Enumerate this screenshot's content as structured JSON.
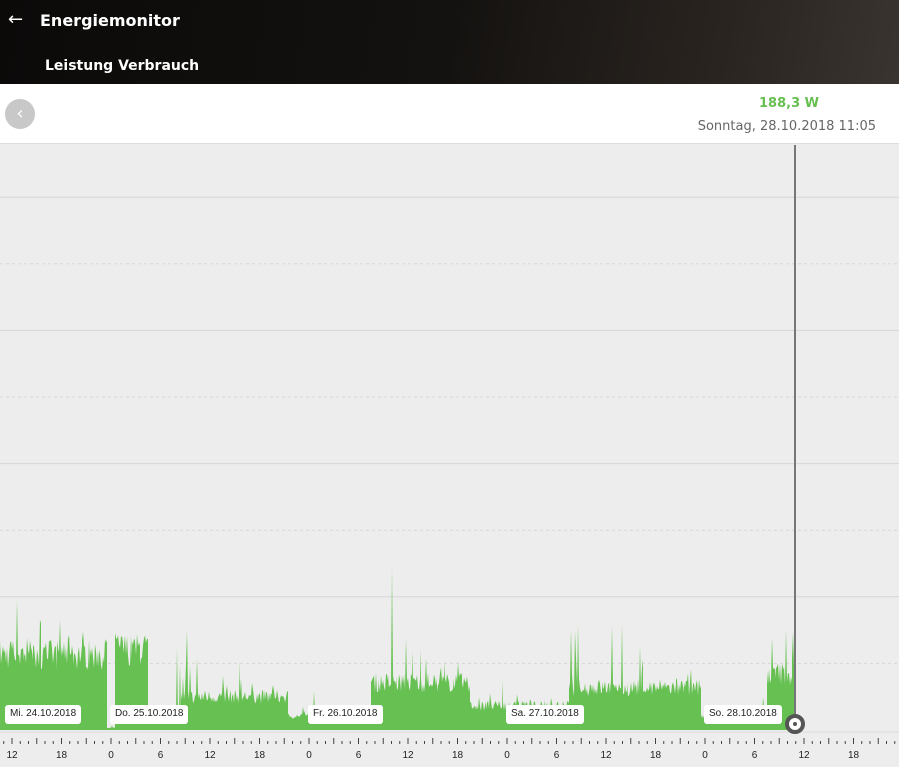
{
  "header": {
    "back_icon": "arrow-left-icon",
    "title": "Energiemonitor",
    "subtitle": "Leistung Verbrauch"
  },
  "info": {
    "prev_icon": "chevron-left-icon",
    "value": "188,3 W",
    "timestamp": "Sonntag, 28.10.2018 11:05"
  },
  "colors": {
    "area": "#66c152",
    "value": "#66bf4f",
    "cursor": "#777777"
  },
  "chart_data": {
    "type": "area",
    "title": "Leistung Verbrauch",
    "ylabel": "W",
    "ylim": [
      0,
      2750
    ],
    "x_start": "24.10.2018 12:00",
    "x_step": "1h",
    "hourly_base_w": [
      375,
      375,
      375,
      375,
      375,
      375,
      375,
      375,
      375,
      375,
      375,
      375,
      10,
      400,
      400,
      400,
      400,
      70,
      70,
      70,
      70,
      165,
      165,
      165,
      165,
      165,
      165,
      165,
      165,
      165,
      165,
      165,
      165,
      165,
      70,
      70,
      70,
      70,
      70,
      70,
      70,
      70,
      70,
      70,
      235,
      235,
      235,
      235,
      235,
      235,
      235,
      235,
      235,
      235,
      235,
      235,
      120,
      120,
      120,
      120,
      120,
      120,
      120,
      120,
      120,
      120,
      120,
      120,
      210,
      210,
      210,
      210,
      210,
      210,
      210,
      210,
      210,
      210,
      210,
      210,
      210,
      210,
      210,
      210,
      70,
      70,
      70,
      70,
      70,
      70,
      70,
      70,
      280,
      280,
      280,
      280
    ],
    "hourly_peak_w": [
      480,
      775,
      480,
      500,
      470,
      480,
      470,
      460,
      470,
      460,
      450,
      420,
      20,
      470,
      470,
      470,
      460,
      120,
      120,
      400,
      560,
      560,
      380,
      300,
      330,
      300,
      260,
      300,
      330,
      280,
      260,
      250,
      240,
      230,
      110,
      110,
      110,
      190,
      120,
      110,
      110,
      120,
      100,
      110,
      800,
      700,
      780,
      560,
      600,
      420,
      450,
      400,
      360,
      330,
      300,
      280,
      200,
      220,
      180,
      250,
      200,
      180,
      160,
      200,
      170,
      160,
      140,
      160,
      500,
      560,
      640,
      600,
      540,
      480,
      480,
      440,
      420,
      380,
      280,
      260,
      300,
      300,
      280,
      250,
      120,
      110,
      140,
      130,
      110,
      120,
      150,
      160,
      640,
      650,
      600,
      520
    ],
    "x_tick_labels": [
      "12",
      "18",
      "0",
      "6",
      "12",
      "18",
      "0",
      "6",
      "12",
      "18",
      "0",
      "6",
      "12",
      "18",
      "0",
      "6",
      "12",
      "18"
    ],
    "day_labels": [
      "Mi. 24.10.2018",
      "Do. 25.10.2018",
      "Fr. 26.10.2018",
      "Sa. 27.10.2018",
      "So. 28.10.2018"
    ],
    "cursor": {
      "time": "28.10.2018 11:05",
      "value_w": 188.3
    }
  }
}
